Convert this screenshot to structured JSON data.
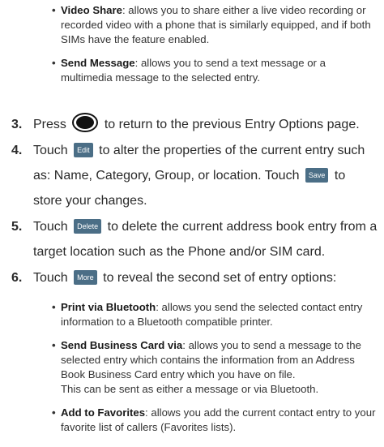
{
  "top_bullets": [
    {
      "term": "Video Share",
      "text": ": allows you to share either a live video recording or recorded video with a phone that is similarly equipped, and if both SIMs have the feature enabled."
    },
    {
      "term": "Send Message",
      "text": ": allows you to send a text message or a multimedia message to the selected entry."
    }
  ],
  "steps": {
    "s3": {
      "num": "3.",
      "before": "Press",
      "after": "to return to the previous Entry Options page."
    },
    "s4": {
      "num": "4.",
      "before": "Touch",
      "chip": "Edit",
      "mid": "to alter the properties of the current entry such as: Name, Category, Group, or location. Touch",
      "chip2": "Save",
      "after": "to store your changes."
    },
    "s5": {
      "num": "5.",
      "before": "Touch",
      "chip": "Delete",
      "after": "to delete the current address book entry from a target location such as the Phone and/or SIM card."
    },
    "s6": {
      "num": "6.",
      "before": "Touch",
      "chip": "More",
      "after": "to reveal the second set of entry options:"
    }
  },
  "bottom_bullets": [
    {
      "term": "Print via Bluetooth",
      "text": ": allows you send the selected contact entry information to a Bluetooth compatible printer."
    },
    {
      "term": "Send Business Card via",
      "text": ": allows you to send a message to the selected entry which contains the information from an Address Book Business Card entry which you have on file.",
      "extra": "This can be sent as either a message or via Bluetooth."
    },
    {
      "term": "Add to Favorites",
      "text": ": allows you add the current contact entry to your favorite list of callers (Favorites lists)."
    }
  ]
}
